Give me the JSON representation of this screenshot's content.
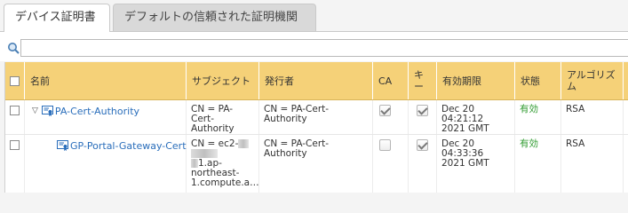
{
  "tabs": [
    {
      "label": "デバイス証明書"
    },
    {
      "label": "デフォルトの信頼された証明機関"
    }
  ],
  "search": {
    "value": "",
    "placeholder": ""
  },
  "table": {
    "headers": {
      "name": "名前",
      "subject": "サブジェクト",
      "issuer": "発行者",
      "ca": "CA",
      "key": "キー",
      "expires": "有効期限",
      "status": "状態",
      "algorithm": "アルゴリズム"
    },
    "rows": [
      {
        "name": "PA-Cert-Authority",
        "subject": "CN = PA-Cert-Authority",
        "issuer": "CN = PA-Cert-Authority",
        "ca": true,
        "key": true,
        "expires": "Dec 20 04:21:12 2021 GMT",
        "status": "有効",
        "algorithm": "RSA"
      },
      {
        "name": "GP-Portal-Gateway-Cert",
        "subject_lines": [
          "CN = ec2-",
          "",
          "1.ap-",
          "northeast-",
          "1.compute.a…"
        ],
        "issuer": "CN = PA-Cert-Authority",
        "ca": false,
        "key": true,
        "expires": "Dec 20 04:33:36 2021 GMT",
        "status": "有効",
        "algorithm": "RSA"
      }
    ]
  },
  "colors": {
    "header_bg": "#f5d178",
    "link": "#2a6ebb",
    "valid": "#2e9a2e"
  }
}
